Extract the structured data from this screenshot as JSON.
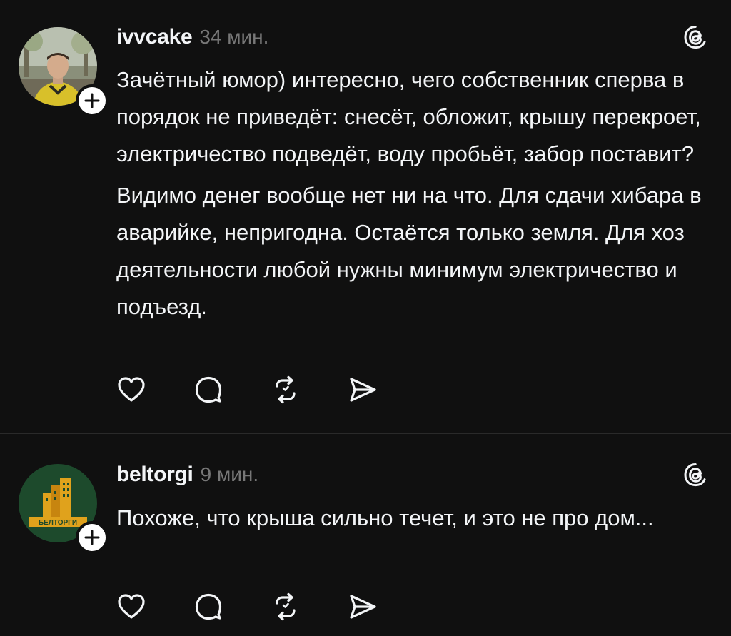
{
  "posts": [
    {
      "username": "ivvcake",
      "time": "34 мин.",
      "paragraphs": [
        "Зачётный юмор) интересно, чего собственник сперва в порядок не приведёт: снесёт, обложит, крышу перекроет, электричество подведёт, воду пробьёт, забор поставит?",
        "Видимо денег вообще нет ни на что. Для сдачи хибара в аварийке, непригодна. Остаётся только земля. Для хоз деятельности любой нужны минимум электричество и подъезд."
      ],
      "avatar_icon": "person-photo-avatar"
    },
    {
      "username": "beltorgi",
      "time": "9 мин.",
      "paragraphs": [
        "Похоже, что крыша сильно течет, и это не про дом..."
      ],
      "avatar_icon": "beltorgi-logo-avatar",
      "avatar_logo_text": "БЕЛТОРГИ"
    }
  ],
  "actions": [
    "heart-icon",
    "comment-icon",
    "repost-icon",
    "share-icon"
  ],
  "colors": {
    "background": "#101010",
    "text": "#f3f5f7",
    "muted": "#777777",
    "divider": "#2a2a2a",
    "beltorgi_green": "#1d4a2c",
    "beltorgi_gold": "#e0a21c"
  }
}
